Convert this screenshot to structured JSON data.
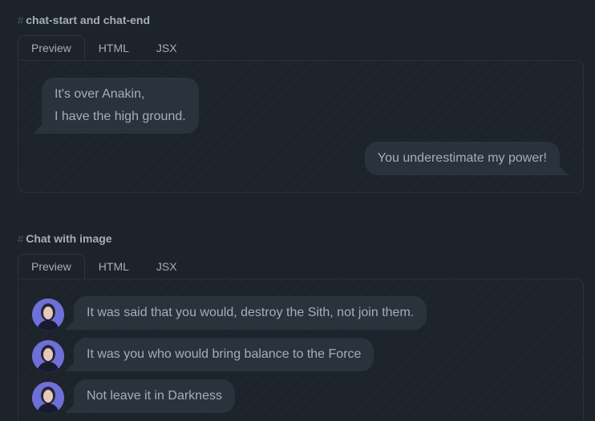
{
  "sections": [
    {
      "hash": "#",
      "title": "chat-start and chat-end",
      "tabs": [
        "Preview",
        "HTML",
        "JSX"
      ],
      "active_tab": "Preview",
      "messages": [
        {
          "side": "start",
          "lines": [
            "It's over Anakin,",
            "I have the high ground."
          ]
        },
        {
          "side": "end",
          "lines": [
            "You underestimate my power!"
          ]
        }
      ]
    },
    {
      "hash": "#",
      "title": "Chat with image",
      "tabs": [
        "Preview",
        "HTML",
        "JSX"
      ],
      "active_tab": "Preview",
      "messages": [
        {
          "side": "start",
          "avatar": true,
          "lines": [
            "It was said that you would, destroy the Sith, not join them."
          ]
        },
        {
          "side": "start",
          "avatar": true,
          "lines": [
            "It was you who would bring balance to the Force"
          ]
        },
        {
          "side": "start",
          "avatar": true,
          "lines": [
            "Not leave it in Darkness"
          ]
        }
      ]
    }
  ],
  "colors": {
    "page_bg": "#1d232a",
    "bubble_bg": "#2a323c",
    "text": "#a6adbb",
    "avatar_bg": "#6f6fd8"
  }
}
